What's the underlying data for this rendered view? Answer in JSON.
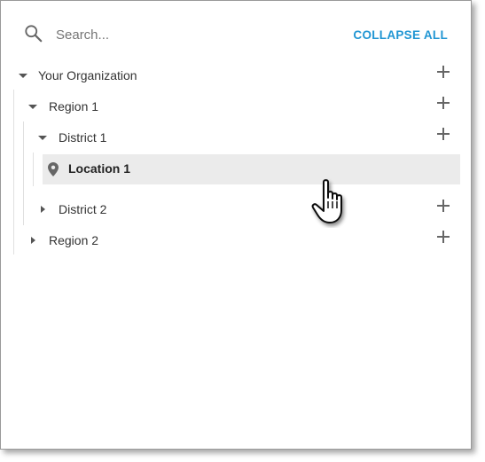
{
  "search": {
    "placeholder": "Search...",
    "value": ""
  },
  "toolbar": {
    "collapse_all": "COLLAPSE ALL"
  },
  "tree": {
    "org": {
      "label": "Your Organization",
      "expanded": true
    },
    "region1": {
      "label": "Region 1",
      "expanded": true
    },
    "district1": {
      "label": "District 1",
      "expanded": true
    },
    "location1": {
      "label": "Location 1",
      "selected": true
    },
    "district2": {
      "label": "District 2",
      "expanded": false
    },
    "region2": {
      "label": "Region 2",
      "expanded": false
    }
  },
  "icons": {
    "search": "search-icon",
    "add": "plus-icon",
    "location": "map-pin-icon",
    "cursor": "hand-pointer-icon"
  },
  "colors": {
    "accent": "#2196d3",
    "selected_row": "#ebebeb"
  }
}
